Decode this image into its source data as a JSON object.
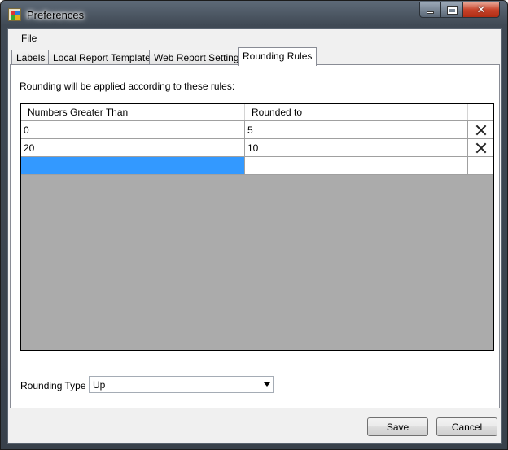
{
  "window": {
    "title": "Preferences"
  },
  "menu": {
    "file": "File"
  },
  "tabs": [
    {
      "label": "Labels"
    },
    {
      "label": "Local Report Templates"
    },
    {
      "label": "Web Report Settings"
    },
    {
      "label": "Rounding Rules"
    }
  ],
  "active_tab": "Rounding Rules",
  "rounding": {
    "intro": "Rounding will be applied according to these rules:",
    "columns": [
      "Numbers Greater Than",
      "Rounded to"
    ],
    "rows": [
      {
        "greater_than": "0",
        "rounded_to": "5"
      },
      {
        "greater_than": "20",
        "rounded_to": "10"
      }
    ],
    "new_row": {
      "greater_than": "",
      "rounded_to": ""
    },
    "type_label": "Rounding Type",
    "type_value": "Up"
  },
  "buttons": {
    "save": "Save",
    "cancel": "Cancel"
  },
  "icons": {
    "delete_row": "close-icon",
    "dropdown": "chevron-down-icon"
  },
  "colors": {
    "selection": "#3399ff",
    "grid_background": "#ababab",
    "close_button": "#c7432a"
  }
}
